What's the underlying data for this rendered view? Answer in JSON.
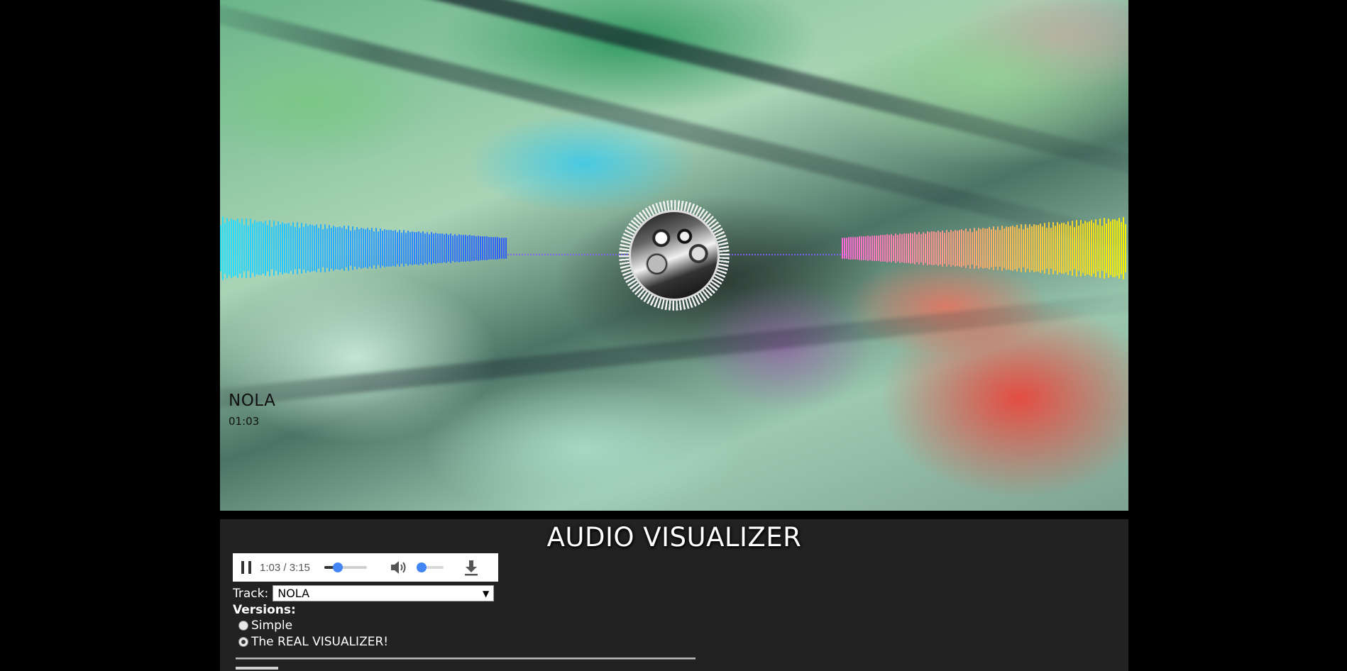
{
  "visualizer": {
    "track_name": "NOLA",
    "track_time": "01:03",
    "colors": {
      "left_bars_start": "#29e0ff",
      "left_bars_end": "#2f5dff",
      "right_bars_start": "#ff6ad5",
      "right_bars_end": "#f5f000",
      "center_line": "#8060ff"
    }
  },
  "panel": {
    "title": "AUDIO VISUALIZER",
    "player": {
      "time": "1:03 / 3:15",
      "progress": 0.32,
      "volume": 0.1
    },
    "track_label": "Track",
    "track_selected": "NOLA",
    "versions_label": "Versions:",
    "versions": [
      {
        "label": "Simple",
        "checked": false
      },
      {
        "label": "The REAL VISUALIZER!",
        "checked": true
      }
    ]
  }
}
